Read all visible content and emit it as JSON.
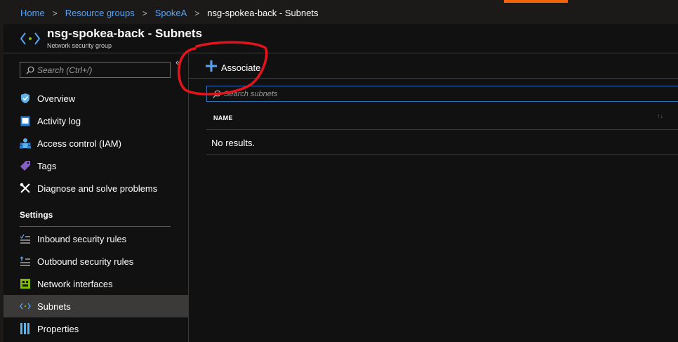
{
  "breadcrumb": {
    "items": [
      "Home",
      "Resource groups",
      "SpokeA"
    ],
    "current": "nsg-spokea-back - Subnets"
  },
  "header": {
    "title": "nsg-spokea-back - Subnets",
    "subtitle": "Network security group"
  },
  "nav": {
    "search_placeholder": "Search (Ctrl+/)",
    "collapse_glyph": "«",
    "items": [
      {
        "label": "Overview",
        "icon": "shield-icon"
      },
      {
        "label": "Activity log",
        "icon": "activity-log-icon"
      },
      {
        "label": "Access control (IAM)",
        "icon": "people-icon"
      },
      {
        "label": "Tags",
        "icon": "tag-icon"
      },
      {
        "label": "Diagnose and solve problems",
        "icon": "wrench-icon"
      }
    ],
    "section": "Settings",
    "settings_items": [
      {
        "label": "Inbound security rules",
        "icon": "inbound-rules-icon"
      },
      {
        "label": "Outbound security rules",
        "icon": "outbound-rules-icon"
      },
      {
        "label": "Network interfaces",
        "icon": "network-interface-icon"
      },
      {
        "label": "Subnets",
        "icon": "subnet-icon",
        "selected": true
      },
      {
        "label": "Properties",
        "icon": "properties-icon"
      }
    ]
  },
  "toolbar": {
    "associate_label": "Associate"
  },
  "filter": {
    "placeholder": "Search subnets"
  },
  "grid": {
    "columns": [
      "NAME"
    ],
    "empty_text": "No results."
  },
  "colors": {
    "accent_orange": "#f7630c",
    "link_blue": "#5aa2f0",
    "annotation_red": "#e3141b",
    "selected_bg": "#3b3a39"
  }
}
